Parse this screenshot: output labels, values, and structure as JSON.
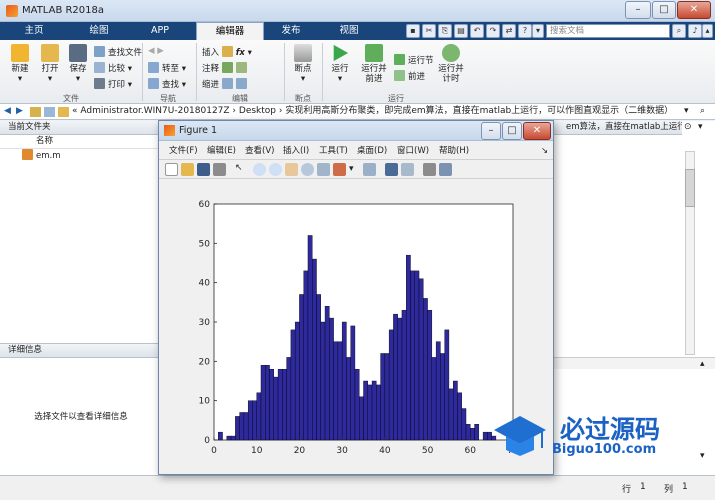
{
  "window": {
    "title": "MATLAB R2018a"
  },
  "tabs": [
    {
      "label": "主页"
    },
    {
      "label": "绘图"
    },
    {
      "label": "APP"
    },
    {
      "label": "编辑器"
    },
    {
      "label": "发布"
    },
    {
      "label": "视图"
    }
  ],
  "search": {
    "placeholder": "搜索文档"
  },
  "ribbon": {
    "new": "新建",
    "open": "打开",
    "save": "保存",
    "find_files": "查找文件",
    "compare": "比较",
    "print": "打印",
    "goto": "转至",
    "find": "查找",
    "insert": "插入",
    "comment": "注释",
    "indent": "缩进",
    "breakpoints": "断点",
    "run": "运行",
    "run_advance_1": "运行并",
    "run_advance_2": "前进",
    "run_section": "运行节",
    "advance": "前进",
    "run_time_1": "运行并",
    "run_time_2": "计时",
    "groups": {
      "file": "文件",
      "nav": "导航",
      "edit": "编辑",
      "bp": "断点",
      "run": "运行"
    }
  },
  "address": {
    "path": "« Administrator.WIN7U-20180127Z  ›  Desktop  ›  实现利用高斯分布聚类，即完成em算法，直接在matlab上运行，可以作图直观显示（二维数据）",
    "overflow": "em算法，直接在matlab上运行..."
  },
  "file_panel": {
    "title": "当前文件夹",
    "col_name": "名称",
    "files": [
      {
        "name": "em.m"
      }
    ]
  },
  "detail_panel": {
    "title": "详细信息",
    "hint": "选择文件以查看详细信息"
  },
  "figure": {
    "title": "Figure 1",
    "menu": [
      "文件(F)",
      "编辑(E)",
      "查看(V)",
      "插入(I)",
      "工具(T)",
      "桌面(D)",
      "窗口(W)",
      "帮助(H)"
    ]
  },
  "status": {
    "row_label": "行",
    "row": "1",
    "col_label": "列",
    "col": "1"
  },
  "watermark": {
    "text": "必过源码",
    "url": "Biguo100.com"
  },
  "chart_data": {
    "type": "bar",
    "x_ticks": [
      0,
      10,
      20,
      30,
      40,
      50,
      60,
      70
    ],
    "y_ticks": [
      0,
      10,
      20,
      30,
      40,
      50,
      60
    ],
    "xlim": [
      0,
      70
    ],
    "ylim": [
      0,
      60
    ],
    "bar_color": "#2e2a9e",
    "bins_start": 1,
    "bin_width": 1,
    "values": [
      2,
      0,
      1,
      1,
      6,
      7,
      7,
      10,
      10,
      12,
      19,
      19,
      18,
      16,
      18,
      18,
      21,
      28,
      30,
      37,
      43,
      52,
      46,
      37,
      30,
      34,
      31,
      25,
      25,
      30,
      21,
      29,
      18,
      11,
      15,
      14,
      15,
      14,
      22,
      22,
      28,
      32,
      31,
      33,
      47,
      43,
      43,
      41,
      36,
      33,
      21,
      25,
      22,
      28,
      13,
      15,
      12,
      8,
      4,
      3,
      4,
      0,
      2,
      2,
      1,
      0,
      0,
      0,
      0,
      0
    ]
  }
}
